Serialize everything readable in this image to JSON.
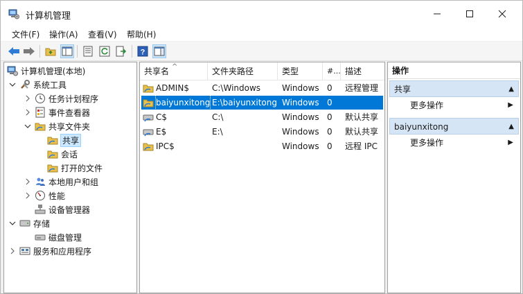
{
  "window": {
    "title": "计算机管理",
    "minimize_glyph": "—",
    "maximize_glyph": "☐",
    "close_glyph": "✕"
  },
  "menu": [
    {
      "label": "文件(F)"
    },
    {
      "label": "操作(A)"
    },
    {
      "label": "查看(V)"
    },
    {
      "label": "帮助(H)"
    }
  ],
  "toolbar": {
    "icons": [
      "back-arrow-icon",
      "forward-arrow-icon",
      "up-folder-icon",
      "show-hide-tree-icon",
      "properties-icon",
      "refresh-icon",
      "export-list-icon",
      "help-icon",
      "show-hide-action-pane-icon"
    ]
  },
  "tree": {
    "root": "计算机管理(本地)",
    "system_tools": "系统工具",
    "task_scheduler": "任务计划程序",
    "event_viewer": "事件查看器",
    "shared_folders": "共享文件夹",
    "shares": "共享",
    "sessions": "会话",
    "open_files": "打开的文件",
    "local_users": "本地用户和组",
    "performance": "性能",
    "device_manager": "设备管理器",
    "storage": "存储",
    "disk_management": "磁盘管理",
    "services_apps": "服务和应用程序"
  },
  "list": {
    "columns": {
      "share_name": "共享名",
      "folder_path": "文件夹路径",
      "type": "类型",
      "clients": "#...",
      "description": "描述"
    },
    "rows": [
      {
        "name": "ADMIN$",
        "path": "C:\\Windows",
        "type": "Windows",
        "clients": "0",
        "desc": "远程管理"
      },
      {
        "name": "baiyunxitong",
        "path": "E:\\baiyunxitong",
        "type": "Windows",
        "clients": "0",
        "desc": ""
      },
      {
        "name": "C$",
        "path": "C:\\",
        "type": "Windows",
        "clients": "0",
        "desc": "默认共享"
      },
      {
        "name": "E$",
        "path": "E:\\",
        "type": "Windows",
        "clients": "0",
        "desc": "默认共享"
      },
      {
        "name": "IPC$",
        "path": "",
        "type": "Windows",
        "clients": "0",
        "desc": "远程 IPC"
      }
    ]
  },
  "actions": {
    "title": "操作",
    "section1": "共享",
    "section1_item": "更多操作",
    "section2": "baiyunxitong",
    "section2_item": "更多操作"
  },
  "colors": {
    "selection": "#0078d7",
    "section_bg": "#d6e5f5"
  }
}
